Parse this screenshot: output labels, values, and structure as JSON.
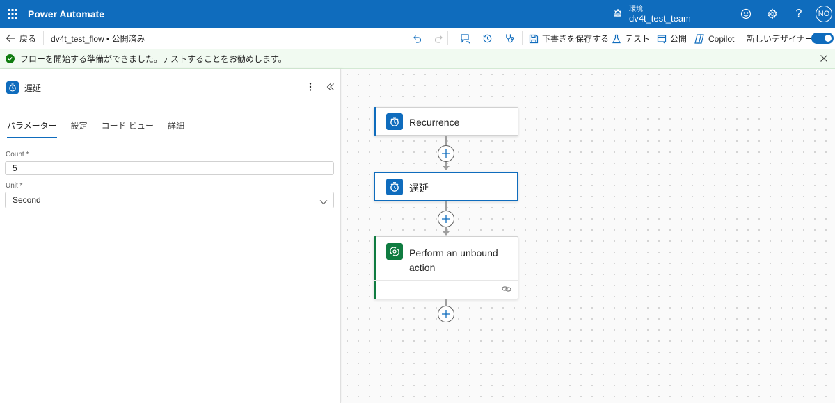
{
  "header": {
    "app_title": "Power Automate",
    "env_label": "環境",
    "env_name": "dv4t_test_team",
    "avatar_initials": "NO",
    "help_glyph": "?"
  },
  "commandbar": {
    "back_label": "戻る",
    "flow_name": "dv4t_test_flow • 公開済み",
    "save_draft_label": "下書きを保存する",
    "test_label": "テスト",
    "publish_label": "公開",
    "copilot_label": "Copilot",
    "new_designer_label": "新しいデザイナー"
  },
  "message": {
    "text": "フローを開始する準備ができました。テストすることをお勧めします。"
  },
  "panel": {
    "title": "遅延",
    "tabs": [
      "パラメーター",
      "設定",
      "コード ビュー",
      "詳細"
    ],
    "count_label": "Count *",
    "count_value": "5",
    "unit_label": "Unit *",
    "unit_value": "Second"
  },
  "canvas": {
    "nodes": [
      {
        "label": "Recurrence",
        "icon": "timer-icon"
      },
      {
        "label": "遅延",
        "icon": "timer-icon"
      },
      {
        "label_line1": "Perform an unbound",
        "label_line2": "action",
        "icon": "dataverse-icon"
      }
    ]
  },
  "colors": {
    "brand": "#0f6cbd",
    "success": "#107c10",
    "dataverse": "#107c41"
  }
}
